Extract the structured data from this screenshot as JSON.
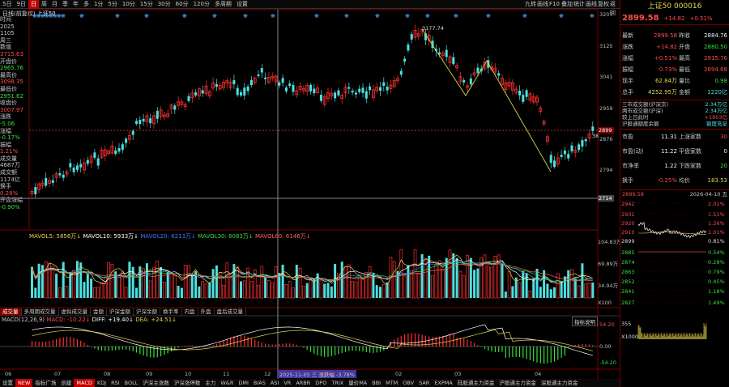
{
  "toolbar": {
    "items": [
      "5日",
      "9日",
      "日",
      "周",
      "月",
      "季",
      "年",
      "多",
      "1分",
      "5分",
      "10分",
      "15分",
      "30分",
      "60分",
      "120分",
      "多周期",
      "设置"
    ],
    "active_index": 2,
    "right": [
      "九转",
      "画线",
      "F10",
      "叠加",
      "统计",
      "画线",
      "复权",
      "返回"
    ]
  },
  "main": {
    "title": "日线(前复权)",
    "index_label": "上证50",
    "peak_label": "3177.74",
    "y_ticks": [
      "3207",
      "3125",
      "3041",
      "2959",
      "2876",
      "2794",
      "2714"
    ],
    "current_price_tag": "2899",
    "crosshair_y_tag": "2714",
    "side_tag": "38"
  },
  "left_info": [
    {
      "label": "时间",
      "value": "2025",
      "c": "lab"
    },
    {
      "label": "",
      "value": "1105",
      "c": "lab"
    },
    {
      "label": "",
      "value": "周三",
      "c": "lab"
    },
    {
      "label": "数值",
      "value": "3715.63",
      "c": "red"
    },
    {
      "label": "开盘价",
      "value": "2965.76",
      "c": "grn"
    },
    {
      "label": "最高价",
      "value": "3098.35",
      "c": "red"
    },
    {
      "label": "最低价",
      "value": "2951.62",
      "c": "grn"
    },
    {
      "label": "收盘价",
      "value": "3007.97",
      "c": "red"
    },
    {
      "label": "涨跌",
      "value": "-5.06",
      "c": "grn"
    },
    {
      "label": "涨幅",
      "value": "-0.17%",
      "c": "grn"
    },
    {
      "label": "振幅",
      "value": "1.21%",
      "c": "red"
    },
    {
      "label": "成交量",
      "value": "4687万",
      "c": "lab"
    },
    {
      "label": "成交额",
      "value": "1174亿",
      "c": "lab"
    },
    {
      "label": "换手",
      "value": "0.28%",
      "c": "red"
    },
    {
      "label": "开盘涨幅",
      "value": "-0.90%",
      "c": "grn"
    }
  ],
  "volume": {
    "legend": [
      {
        "t": "MAVOL5: 5856万↓",
        "c": "#e8d44d"
      },
      {
        "t": "MAVOL10: 5933万↓",
        "c": "#ffffff"
      },
      {
        "t": "MAVOL20: 6213万↓",
        "c": "#3a78ff"
      },
      {
        "t": "MAVOL30: 6083万↓",
        "c": "#3adf3a"
      },
      {
        "t": "MAVOL60: 6146万↓",
        "c": "#ff6060"
      }
    ],
    "y_ticks": [
      "104.83万",
      "69.89万",
      "34.94万",
      "X100"
    ]
  },
  "indicator_tabs": [
    "成交量",
    "多周期成交量",
    "虚拟成交量",
    "金额",
    "沪深金额",
    "沪深余额",
    "换手率",
    "内盘",
    "外盘",
    "盘后成交量"
  ],
  "macd": {
    "legend": "MACD(12,26,9)",
    "macd_label": "MACD: -10.22↓",
    "diff_label": "DIFF: +19.40↓",
    "dea_label": "DEA: +24.51↓",
    "y_ticks": [
      "54.20",
      "0.00",
      "-54.20"
    ],
    "help": "指标说明"
  },
  "x_axis": {
    "labels": [
      "06",
      "07",
      "08",
      "09",
      "10",
      "11",
      "12",
      "01",
      "02",
      "03",
      "04"
    ],
    "crosshair_date": "2025-11-05 三  涨跌幅 -3.78%"
  },
  "bottom_bar": [
    "设置",
    "NEW",
    "指标广场",
    "创建",
    "MACD",
    "KDJ",
    "RSI",
    "BOLL",
    "沪深主涨数",
    "沪深涨停数",
    "主力",
    "W&R",
    "DMI",
    "BIAS",
    "ASI",
    "VR",
    "ARBR",
    "DPO",
    "TRIX",
    "量价MA",
    "BBI",
    "MTM",
    "OBV",
    "SAR",
    "EXPMA",
    "陆股通主力资金",
    "沪股通主力资金",
    "深股通主力资金"
  ],
  "right_panel": {
    "title": "上证50 000016",
    "price": "2899.58",
    "change": "+14.82",
    "pct": "+0.51%",
    "quote": [
      [
        "最新",
        "2899.58",
        "red",
        "昨收",
        "2884.76",
        "wht"
      ],
      [
        "涨跌",
        "+14.82",
        "red",
        "开盘",
        "2880.50",
        "grn"
      ],
      [
        "涨幅",
        "+0.51%",
        "red",
        "最高",
        "2915.76",
        "red"
      ],
      [
        "振幅",
        "0.73%",
        "red",
        "最低",
        "2894.68",
        "red"
      ],
      [
        "现手",
        "62.84万",
        "yel",
        "量比",
        "0.98",
        "grn"
      ],
      [
        "总手",
        "4252.95万",
        "yel",
        "金额",
        "1220亿",
        "cyn"
      ]
    ],
    "notes": [
      "三市成交额(沪深京)",
      "两市成交额(沪深)",
      "较上日此时",
      "沪股通额度余额"
    ],
    "note_vals": [
      "2.34万亿",
      "2.34万亿",
      "+1903亿",
      "额度充足"
    ],
    "breadth": [
      [
        "市盈",
        "11.31",
        "上涨家数",
        "30"
      ],
      [
        "市盈(动)",
        "11.22",
        "平盘家数",
        "0"
      ],
      [
        "市净率",
        "1.22",
        "下跌家数",
        "20"
      ],
      [
        "换手",
        "0.25%",
        "均价",
        "183.53"
      ]
    ],
    "intraday": {
      "price": "2899.58",
      "date": "2026-04-10 五",
      "left_ticks": [
        "2942",
        "2931",
        "2920",
        "2910",
        "2899",
        "2885",
        "2874",
        "2863",
        "2852",
        "2841",
        "2827"
      ],
      "right_ticks": [
        "2.01%",
        "1.51%",
        "1.26%",
        "1.01%",
        "0.81%",
        "0.54%",
        "0.28%",
        "0.79%",
        "0.45%",
        "1.18%",
        "1.49%"
      ],
      "vol_ticks": [
        "355",
        "X1000"
      ]
    }
  }
}
